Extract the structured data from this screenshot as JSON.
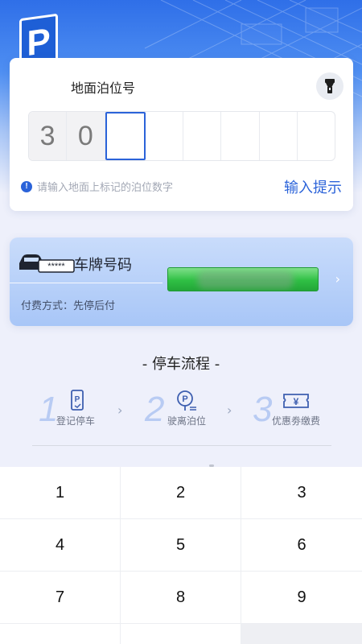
{
  "header": {
    "sign_letter": "P"
  },
  "berth_card": {
    "title": "地面泊位号",
    "digits": [
      "3",
      "0",
      "",
      "",
      "",
      "",
      "",
      ""
    ],
    "hint": "请输入地面上标记的泊位数字",
    "hint_link": "输入提示",
    "info_glyph": "!",
    "torch_icon": "flashlight-icon"
  },
  "plate_card": {
    "title": "车牌号码",
    "plate_mask": "*****",
    "pay_method": "付费方式：先停后付",
    "chevron": "›",
    "plate_color": "#2fbf44"
  },
  "flow": {
    "title": "- 停车流程 -",
    "steps": [
      {
        "num": "1",
        "label": "登记停车",
        "icon": "phone-parking-icon"
      },
      {
        "num": "2",
        "label": "驶离泊位",
        "icon": "parking-pin-icon"
      },
      {
        "num": "3",
        "label": "优惠劵缴费",
        "icon": "coupon-yen-icon"
      }
    ],
    "arrow": "›"
  },
  "keypad": {
    "keys": [
      "1",
      "2",
      "3",
      "4",
      "5",
      "6",
      "7",
      "8",
      "9",
      "",
      "",
      ""
    ]
  },
  "colors": {
    "accent": "#2b63d9",
    "background": "#eef0fb"
  }
}
